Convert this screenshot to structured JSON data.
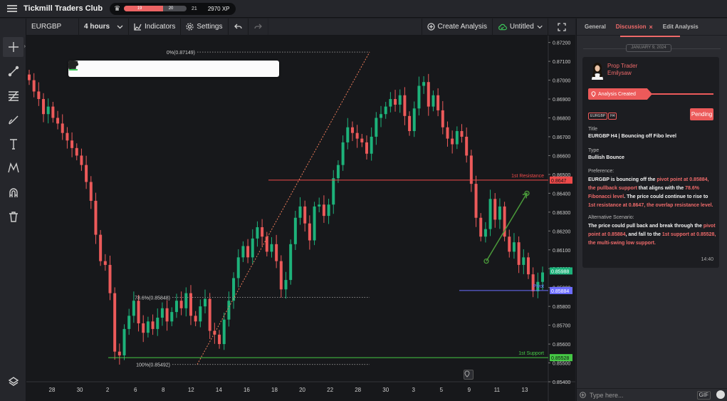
{
  "app": {
    "title": "Tickmill Traders Club",
    "level_badge": "♂",
    "progress_points": [
      "19",
      "20",
      "21"
    ],
    "progress_fraction": 0.62,
    "xp": "2970 XP"
  },
  "toolbar": {
    "symbol": "EURGBP",
    "timeframe": "4 hours",
    "indicators_label": "Indicators",
    "settings_label": "Settings",
    "create_analysis_label": "Create Analysis",
    "layout_name": "Untitled"
  },
  "left_tools": [
    "crosshair-icon",
    "trendline-icon",
    "fib-icon",
    "brush-icon",
    "text-icon",
    "pattern-icon",
    "magnet-icon",
    "trash-icon",
    "layers-icon"
  ],
  "drawing_toolbar": [
    "drag-handle-icon",
    "select-icon",
    "pencil-icon",
    "thick-line-icon",
    "thin-line-icon",
    "arrow-left-icon",
    "arrow-right-icon",
    "gear-icon",
    "copy-icon",
    "clone-icon",
    "lock-icon",
    "eye-icon",
    "trash-icon"
  ],
  "chart_data": {
    "type": "candlestick",
    "symbol": "EURGBP",
    "timeframe": "4 hours",
    "ylim": [
      0.854,
      0.8721
    ],
    "price_ticks": [
      "0.87200",
      "0.87100",
      "0.87000",
      "0.86900",
      "0.86800",
      "0.86700",
      "0.86600",
      "0.86500",
      "0.86400",
      "0.86300",
      "0.86200",
      "0.86100",
      "0.86000",
      "0.85900",
      "0.85800",
      "0.85700",
      "0.85600",
      "0.85500",
      "0.85400"
    ],
    "x_ticks": [
      "28",
      "30",
      "2",
      "6",
      "8",
      "12",
      "14",
      "16",
      "18",
      "20",
      "22",
      "28",
      "30",
      "3",
      "5",
      "9",
      "11",
      "13"
    ],
    "levels": [
      {
        "name": "1st Resistance",
        "price": 0.8647,
        "price_label": "0.8647",
        "color": "#ef4a4a"
      },
      {
        "name": "Pivot",
        "price": 0.85884,
        "price_label": "0.85884",
        "color": "#6d6dff"
      },
      {
        "name": "1st Support",
        "price": 0.85528,
        "price_label": "0.85528",
        "color": "#45c845"
      }
    ],
    "current_price_label": "0.85988",
    "fib_labels": [
      {
        "label": "0%(0.87149)",
        "price": 0.87149
      },
      {
        "label": "78.6%(0.85848)",
        "price": 0.85848
      },
      {
        "label": "100%(0.85492)",
        "price": 0.85492
      }
    ],
    "series": [
      {
        "name": "",
        "values": [
          0.87,
          0.8694,
          0.869,
          0.8682,
          0.8686,
          0.868,
          0.8677,
          0.8672,
          0.8668,
          0.8664,
          0.866,
          0.8655,
          0.8646,
          0.8636,
          0.8618,
          0.8604,
          0.8602,
          0.8587,
          0.8556,
          0.8554,
          0.8568,
          0.8575,
          0.8583,
          0.8571,
          0.8566,
          0.8572,
          0.8568,
          0.8574,
          0.8579,
          0.8572,
          0.8577,
          0.8583,
          0.8579,
          0.8587,
          0.8575,
          0.8572,
          0.858,
          0.8584,
          0.8567,
          0.8565,
          0.856,
          0.8573,
          0.8583,
          0.8595,
          0.8606,
          0.8612,
          0.8606,
          0.8616,
          0.8622,
          0.8617,
          0.8609,
          0.8613,
          0.8604,
          0.8589,
          0.8594,
          0.8613,
          0.8627,
          0.8633,
          0.8624,
          0.8615,
          0.8633,
          0.8634,
          0.8628,
          0.8634,
          0.8648,
          0.8655,
          0.8667,
          0.8675,
          0.8672,
          0.8669,
          0.8667,
          0.8661,
          0.867,
          0.868,
          0.8682,
          0.8686,
          0.869,
          0.8687,
          0.8692,
          0.8681,
          0.8673,
          0.8685,
          0.8697,
          0.8699,
          0.8686,
          0.8692,
          0.8684,
          0.8675,
          0.8669,
          0.8666,
          0.8673,
          0.867,
          0.866,
          0.8645,
          0.8627,
          0.8617,
          0.8621,
          0.8637,
          0.8626,
          0.8633,
          0.8617,
          0.8609,
          0.8614,
          0.8602,
          0.8606,
          0.8597,
          0.8588,
          0.8593,
          0.8598
        ]
      }
    ],
    "projection_arrow": {
      "from_price": 0.8604,
      "to_price": 0.864
    }
  },
  "panel": {
    "tabs": [
      "General",
      "Discussion",
      "Edit Analysis"
    ],
    "active_tab": "Discussion",
    "date": "JANUARY 9, 2024",
    "author_role": "Prop Trader",
    "author_name": "Emilysaw",
    "status_banner": "Analysis Created",
    "tags": [
      "EURGBP",
      "H4"
    ],
    "status": "Pending",
    "title_label": "Title",
    "title_value": "EURGBP H4 | Bouncing off Fibo level",
    "type_label": "Type",
    "type_value": "Bullish Bounce",
    "preference_label": "Preference:",
    "preference_parts": [
      {
        "text": "EURGBP is bouncing off the ",
        "hl": false
      },
      {
        "text": "pivot point at 0.85884, the pullback support",
        "hl": true
      },
      {
        "text": " that aligns with the ",
        "hl": false
      },
      {
        "text": "78.6% Fibonacci level",
        "hl": true
      },
      {
        "text": ". The price could continue to rise to ",
        "hl": false
      },
      {
        "text": "1st resistance at 0.8647, the overlap resistance level.",
        "hl": true
      }
    ],
    "alt_label": "Alternative Scenario:",
    "alt_parts": [
      {
        "text": "The price could pull back and break through the ",
        "hl": false
      },
      {
        "text": "pivot point at 0.85884",
        "hl": true
      },
      {
        "text": ", and fall to the ",
        "hl": false
      },
      {
        "text": "1st support at 0.85528, the multi-swing low support.",
        "hl": true
      }
    ],
    "time": "14:40",
    "composer_placeholder": "Type here...",
    "gif_label": "GIF"
  }
}
